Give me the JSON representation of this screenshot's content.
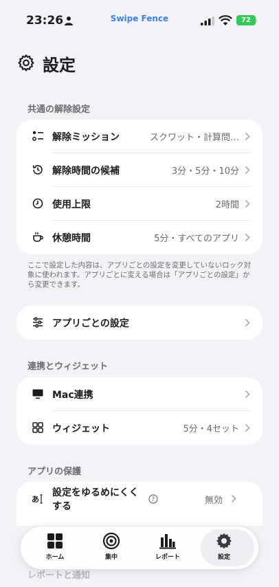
{
  "status": {
    "time": "23:26",
    "app": "Swipe Fence",
    "battery": "72"
  },
  "page": {
    "title": "設定"
  },
  "section1": {
    "header": "共通の解除設定",
    "rows": [
      {
        "label": "解除ミッション",
        "value": "スクワット・計算問…",
        "icon": "mission-icon"
      },
      {
        "label": "解除時間の候補",
        "value": "3分・5分・10分",
        "icon": "history-icon"
      },
      {
        "label": "使用上限",
        "value": "2時間",
        "icon": "clock-icon"
      },
      {
        "label": "休憩時間",
        "value": "5分・すべてのアプリ",
        "icon": "coffee-icon"
      }
    ],
    "note": "ここで設定した内容は、アプリごとの設定を変更していないロック対象に使われます。アプリごとに変える場合は「アプリごとの設定」から変更できます。"
  },
  "per_app": {
    "label": "アプリごとの設定"
  },
  "section2": {
    "header": "連携とウィジェット",
    "rows": [
      {
        "label": "Mac連携",
        "value": ""
      },
      {
        "label": "ウィジェット",
        "value": "5分・4セット"
      }
    ]
  },
  "section3": {
    "header": "アプリの保護",
    "rows": [
      {
        "label": "設定をゆるめにくくする",
        "value": "無効"
      }
    ]
  },
  "section4": {
    "header": "レポートと通知"
  },
  "tabs": [
    {
      "label": "ホーム"
    },
    {
      "label": "集中"
    },
    {
      "label": "レポート"
    },
    {
      "label": "設定",
      "active": true
    }
  ],
  "colors": {
    "accent": "#3b82f6",
    "battery": "#34c759",
    "background": "#f2f2f7"
  }
}
